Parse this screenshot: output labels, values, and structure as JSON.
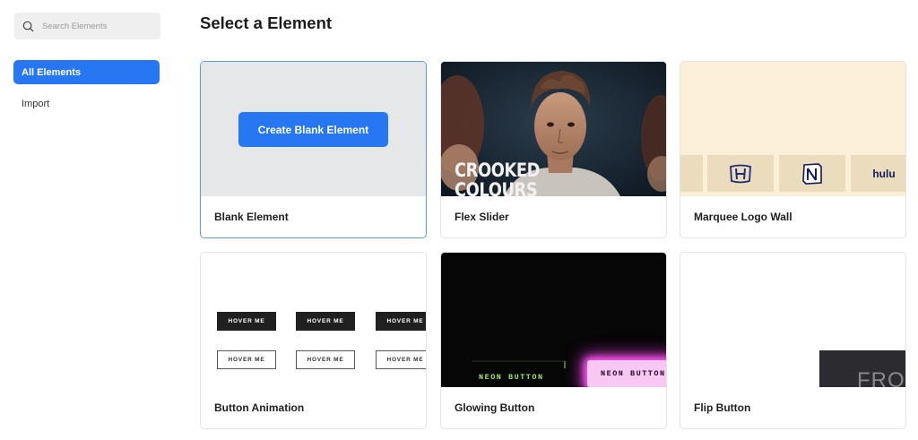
{
  "search": {
    "placeholder": "Search Elements",
    "icon": "search-icon"
  },
  "sidebar": {
    "items": [
      {
        "label": "All Elements",
        "active": true
      },
      {
        "label": "Import",
        "active": false
      }
    ]
  },
  "main": {
    "title": "Select a Element",
    "cards": [
      {
        "label": "Blank Element",
        "selected": true,
        "button_label": "Create Blank Element"
      },
      {
        "label": "Flex Slider",
        "thumb_text": [
          "CROOKED",
          "COLOURS"
        ]
      },
      {
        "label": "Marquee Logo Wall",
        "logos": [
          "honda-logo",
          "notion-logo",
          "hulu"
        ]
      },
      {
        "label": "Button Animation",
        "buttons": [
          "HOVER ME",
          "HOVER ME",
          "HOVER ME",
          "HOVER ME",
          "HOVER ME",
          "HOVER ME"
        ]
      },
      {
        "label": "Glowing Button",
        "green_text": "NEON BUTTON",
        "pink_text": "NEON BUTTON"
      },
      {
        "label": "Flip Button",
        "thumb_text": "FRO"
      }
    ]
  },
  "colors": {
    "accent": "#2877f2",
    "neon_green": "#9fe36b",
    "neon_pink": "#ff5cf0",
    "marquee_bg": "#fcefd8"
  }
}
